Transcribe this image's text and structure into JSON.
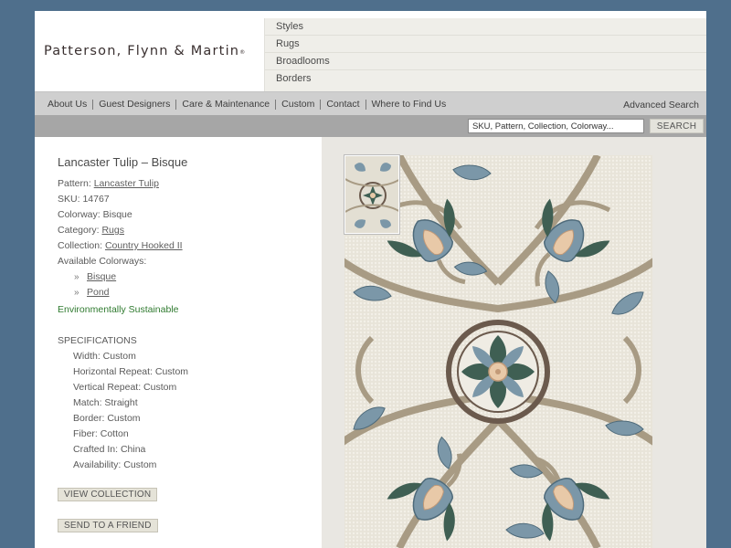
{
  "brand": {
    "logo_text": "Patterson, Flynn & Martin",
    "logo_mark": "®"
  },
  "top_menu": [
    "Styles",
    "Rugs",
    "Broadlooms",
    "Borders"
  ],
  "nav": {
    "links": [
      "About Us",
      "Guest Designers",
      "Care & Maintenance",
      "Custom",
      "Contact",
      "Where to Find Us"
    ],
    "advanced_search": "Advanced Search"
  },
  "search": {
    "placeholder": "SKU, Pattern, Collection, Colorway...",
    "button": "SEARCH"
  },
  "product": {
    "title": "Lancaster Tulip – Bisque",
    "pattern_label": "Pattern: ",
    "pattern": "Lancaster Tulip",
    "sku_label": "SKU: ",
    "sku": "14767",
    "colorway_label": "Colorway: ",
    "colorway": "Bisque",
    "category_label": "Category: ",
    "category": "Rugs",
    "collection_label": "Collection: ",
    "collection": "Country Hooked II",
    "available_label": "Available Colorways:",
    "available_colorways": [
      "Bisque",
      "Pond"
    ],
    "eco": "Environmentally Sustainable"
  },
  "specs": {
    "title": "SPECIFICATIONS",
    "items": [
      "Width: Custom",
      "Horizontal Repeat: Custom",
      "Vertical Repeat: Custom",
      "Match: Straight",
      "Border: Custom",
      "Fiber: Cotton",
      "Crafted In: China",
      "Availability: Custom"
    ]
  },
  "buttons": {
    "view_collection": "VIEW COLLECTION",
    "send_friend": "SEND TO A FRIEND"
  },
  "icons": {
    "colorway_bullet": "double-chevron-right-icon"
  },
  "colors": {
    "page_bg": "#4f6f8c",
    "menu_bg": "#efeee9",
    "nav_bg": "#cfcfcf",
    "search_bg": "#a6a6a6",
    "rug_ground": "#e8e4d9",
    "rug_vine": "#a89b84",
    "rug_blue": "#7b97a8",
    "rug_green": "#3f5f53",
    "rug_peach": "#e8c9a8",
    "rug_brown": "#6b5a4d",
    "eco_green": "#2f7a2f"
  }
}
